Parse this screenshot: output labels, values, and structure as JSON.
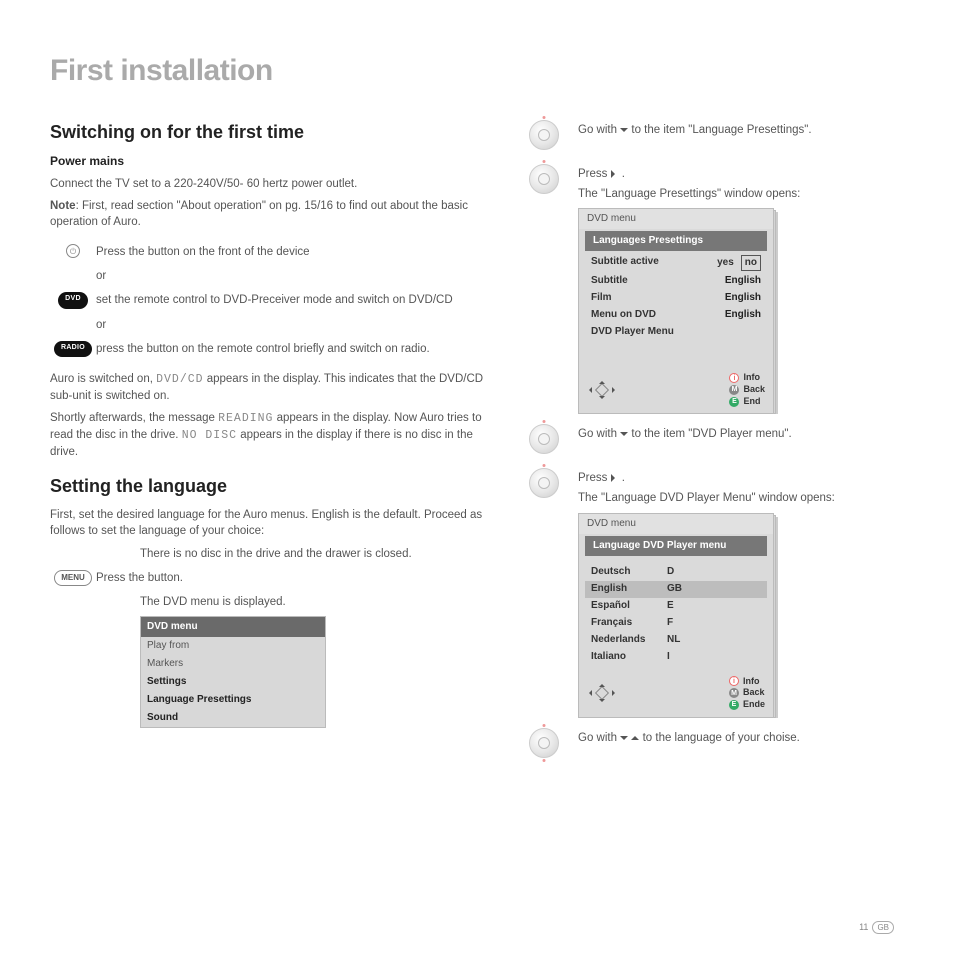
{
  "page_title": "First installation",
  "left": {
    "h2a": "Switching on for the first time",
    "h3a": "Power mains",
    "p1": "Connect the TV set to a 220-240V/50- 60 hertz power outlet.",
    "note_label": "Note",
    "note_text": ": First, read section \"About operation\" on pg. 15/16 to find out about the basic operation of Auro.",
    "step1": "Press the button on the front of the device",
    "or": "or",
    "dvd_label": "DVD",
    "step2": "set the remote control to DVD-Preceiver mode and switch on DVD/CD",
    "radio_label": "RADIO",
    "step3": "press the button on the remote control briefly and switch on radio.",
    "para2a": "Auro is switched on, ",
    "lcd1": "DVD/CD",
    "para2b": " appears in the display. This indicates that the DVD/CD sub-unit is switched on.",
    "para3a": "Shortly afterwards, the message ",
    "lcd2": "READING",
    "para3b": " appears in the display. Now Auro tries to read the disc in the drive. ",
    "lcd3": "NO DISC",
    "para3c": " appears in the display if there is no disc in the drive.",
    "h2b": "Setting the language",
    "p4": "First, set the desired language for the Auro menus. English is the default. Proceed as follows to set the language of your choice:",
    "indent1": "There is no disc in the drive and the drawer is closed.",
    "menu_label": "MENU",
    "step4": "Press the button.",
    "indent2": "The DVD menu is displayed.",
    "dvdmenu": {
      "title": "DVD menu",
      "items": [
        "Play from",
        "Markers",
        "Settings",
        "Language Presettings",
        "Sound"
      ]
    }
  },
  "right": {
    "r1a": "Go with ",
    "r1b": " to the item \"Language Presettings\".",
    "r2a": "Press ",
    "r2b": " .",
    "r2c": "The \"Language Presettings\" window opens:",
    "menu1": {
      "crumb": "DVD menu",
      "title": "Languages Presettings",
      "rows": [
        {
          "k": "Subtitle active",
          "yes": "yes",
          "no": "no"
        },
        {
          "k": "Subtitle",
          "v": "English"
        },
        {
          "k": "Film",
          "v": "English"
        },
        {
          "k": "Menu on DVD",
          "v": "English"
        },
        {
          "k": "DVD Player Menu",
          "v": ""
        }
      ],
      "legend": {
        "i": "Info",
        "m": "Back",
        "e": "End"
      }
    },
    "r3a": "Go with ",
    "r3b": " to the item \"DVD Player menu\".",
    "r4a": "Press ",
    "r4b": " .",
    "r4c": "The \"Language DVD Player Menu\" window opens:",
    "menu2": {
      "crumb": "DVD menu",
      "title": "Language DVD Player menu",
      "rows": [
        {
          "k": "Deutsch",
          "v": "D"
        },
        {
          "k": "English",
          "v": "GB",
          "sel": true
        },
        {
          "k": "Español",
          "v": "E"
        },
        {
          "k": "Français",
          "v": "F"
        },
        {
          "k": "Nederlands",
          "v": "NL"
        },
        {
          "k": "Italiano",
          "v": "I"
        }
      ],
      "legend": {
        "i": "Info",
        "m": "Back",
        "e": "Ende"
      }
    },
    "r5a": "Go with ",
    "r5b": " to the language of your choise."
  },
  "footer": {
    "page": "11",
    "region": "GB"
  }
}
